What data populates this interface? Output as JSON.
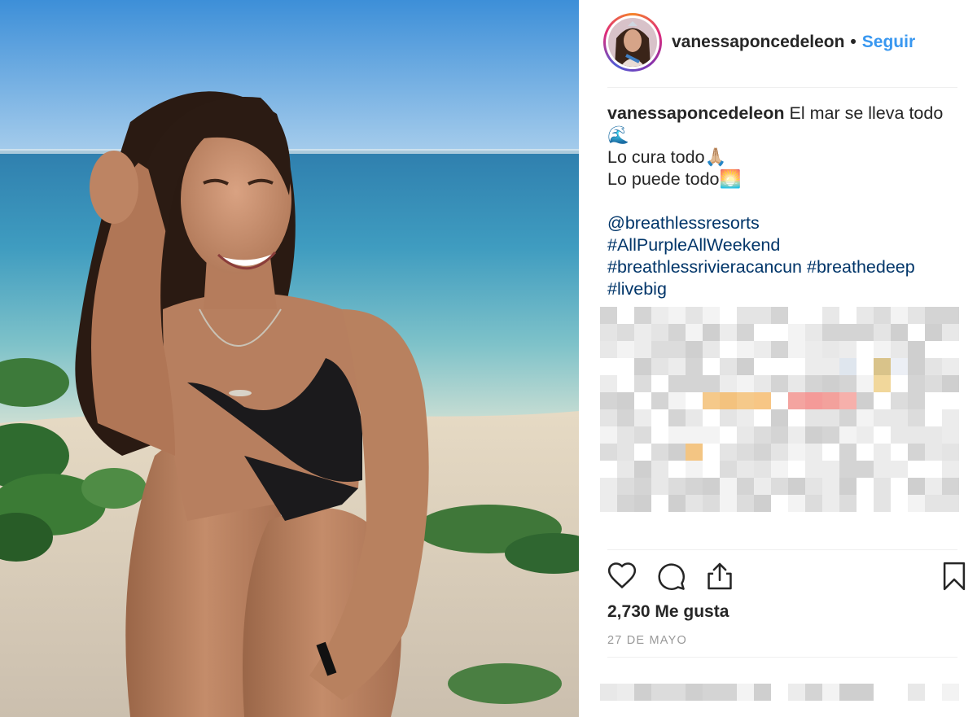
{
  "header": {
    "username": "vanessaponcedeleon",
    "separator": "•",
    "follow_label": "Seguir"
  },
  "caption": {
    "username": "vanessaponcedeleon",
    "line1": "El mar se lleva todo",
    "line1_emoji": "🌊",
    "line2": "Lo cura todo",
    "line2_emoji": "🙏🏼",
    "line3": "Lo puede todo",
    "line3_emoji": "🌅",
    "tags": {
      "mention": "@breathlessresorts",
      "tag1": "#AllPurpleAllWeekend",
      "tag2": "#breathlessrivieracancun",
      "tag3": "#breathedeep",
      "tag4": "#livebig"
    }
  },
  "actions": {
    "like_icon": "heart-icon",
    "comment_icon": "comment-icon",
    "share_icon": "share-icon",
    "save_icon": "bookmark-icon"
  },
  "likes": "2,730 Me gusta",
  "date": "27 DE MAYO",
  "colors": {
    "follow": "#3897f0",
    "hashtag": "#003569",
    "text": "#262626",
    "muted": "#999999"
  }
}
